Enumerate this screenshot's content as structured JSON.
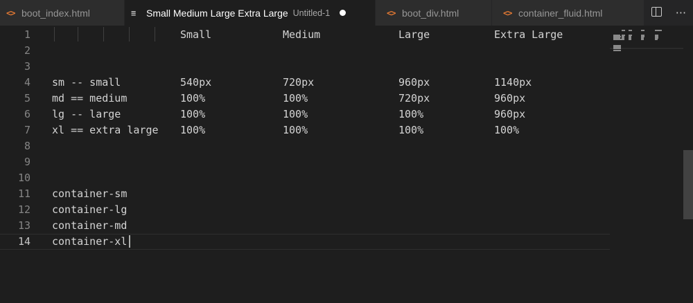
{
  "tabs": [
    {
      "label": "boot_index.html",
      "icon": "html-icon",
      "glyph": "<>",
      "active": false
    },
    {
      "label": "Small Medium Large Extra Large",
      "description": "Untitled-1",
      "icon": "text-file-icon",
      "glyph": "≡",
      "active": true,
      "dirty": true
    },
    {
      "label": "boot_div.html",
      "icon": "html-icon",
      "glyph": "<>",
      "active": false
    },
    {
      "label": "container_fluid.html",
      "icon": "html-icon",
      "glyph": "<>",
      "active": false
    }
  ],
  "actions": {
    "split": "split-editor-icon",
    "more": "···"
  },
  "editor": {
    "current_line": 14,
    "lines": [
      {
        "num": "1",
        "c": [
          "",
          "Small",
          "Medium",
          "Large",
          "Extra Large"
        ]
      },
      {
        "num": "2",
        "c": [
          "",
          "",
          "",
          "",
          ""
        ]
      },
      {
        "num": "3",
        "c": [
          "",
          "",
          "",
          "",
          ""
        ]
      },
      {
        "num": "4",
        "c": [
          "sm -- small",
          "540px",
          "720px",
          "960px",
          "1140px"
        ]
      },
      {
        "num": "5",
        "c": [
          "md == medium",
          "100%",
          "100%",
          "720px",
          "960px"
        ]
      },
      {
        "num": "6",
        "c": [
          "lg -- large",
          "100%",
          "100%",
          "100%",
          "960px"
        ]
      },
      {
        "num": "7",
        "c": [
          "xl == extra large",
          "100%",
          "100%",
          "100%",
          "100%"
        ]
      },
      {
        "num": "8",
        "c": [
          "",
          "",
          "",
          "",
          ""
        ]
      },
      {
        "num": "9",
        "c": [
          "",
          "",
          "",
          "",
          ""
        ]
      },
      {
        "num": "10",
        "c": [
          "",
          "",
          "",
          "",
          ""
        ]
      },
      {
        "num": "11",
        "c": [
          "container-sm",
          "",
          "",
          "",
          ""
        ]
      },
      {
        "num": "12",
        "c": [
          "container-lg",
          "",
          "",
          "",
          ""
        ]
      },
      {
        "num": "13",
        "c": [
          "container-md",
          "",
          "",
          "",
          ""
        ]
      },
      {
        "num": "14",
        "c": [
          "container-xl",
          "",
          "",
          "",
          ""
        ]
      }
    ]
  },
  "colors": {
    "background": "#1e1e1e",
    "text": "#d4d4d4",
    "line_number": "#858585",
    "html_icon": "#e37933"
  }
}
